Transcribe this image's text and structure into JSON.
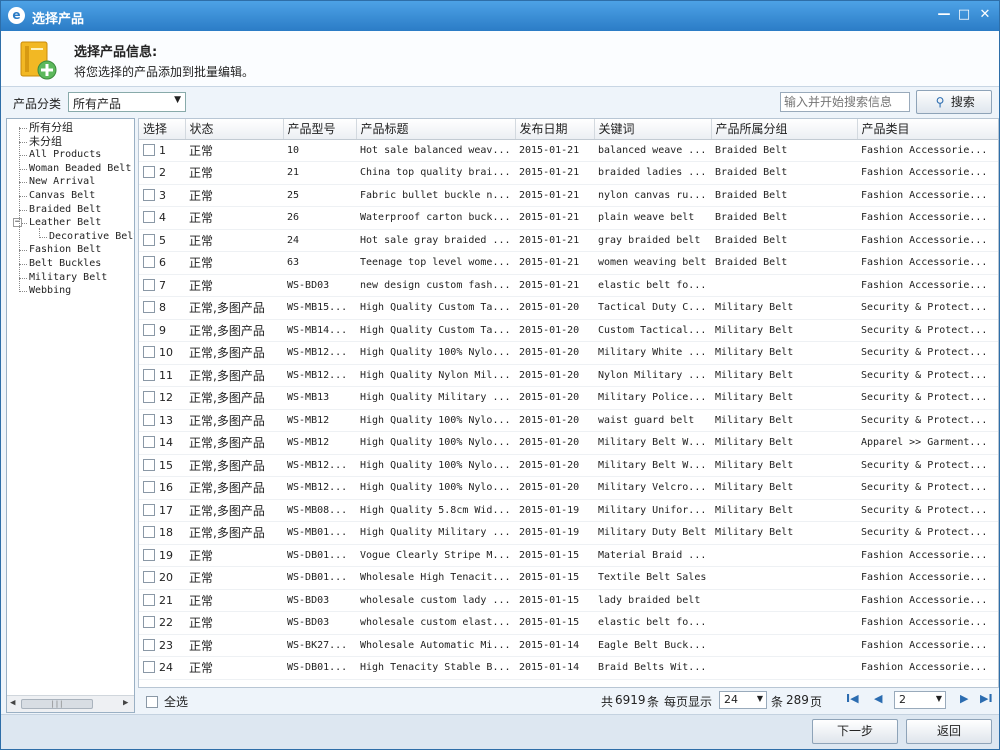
{
  "window": {
    "title": "选择产品",
    "min_glyph": "—",
    "max_glyph": "□",
    "close_glyph": "✕"
  },
  "header": {
    "title": "选择产品信息:",
    "subtitle": "将您选择的产品添加到批量编辑。"
  },
  "filter": {
    "category_label": "产品分类",
    "category_value": "所有产品",
    "search_placeholder": "输入并开始搜索信息",
    "search_button": "搜索"
  },
  "tree": {
    "items": [
      {
        "label": "所有分组",
        "level": 1
      },
      {
        "label": "未分组",
        "level": 1
      },
      {
        "label": "All Products",
        "level": 1
      },
      {
        "label": "Woman Beaded Belt",
        "level": 1
      },
      {
        "label": "New Arrival",
        "level": 1
      },
      {
        "label": "Canvas Belt",
        "level": 1
      },
      {
        "label": "Braided Belt",
        "level": 1
      },
      {
        "label": "Leather Belt",
        "level": 1,
        "expander": "−"
      },
      {
        "label": "Decorative Belt",
        "level": 2
      },
      {
        "label": "Fashion Belt",
        "level": 1
      },
      {
        "label": "Belt Buckles",
        "level": 1
      },
      {
        "label": "Military Belt",
        "level": 1
      },
      {
        "label": "Webbing",
        "level": 1
      }
    ]
  },
  "table": {
    "columns": [
      "选择",
      "状态",
      "产品型号",
      "产品标题",
      "发布日期",
      "关键词",
      "产品所属分组",
      "产品类目"
    ],
    "rows": [
      [
        "1",
        "正常",
        "10",
        "Hot sale balanced weav...",
        "2015-01-21",
        "balanced weave ...",
        "Braided Belt",
        "Fashion Accessorie..."
      ],
      [
        "2",
        "正常",
        "21",
        "China top quality brai...",
        "2015-01-21",
        "braided ladies ...",
        "Braided Belt",
        "Fashion Accessorie..."
      ],
      [
        "3",
        "正常",
        "25",
        "Fabric bullet buckle n...",
        "2015-01-21",
        "nylon canvas ru...",
        "Braided Belt",
        "Fashion Accessorie..."
      ],
      [
        "4",
        "正常",
        "26",
        "Waterproof carton buck...",
        "2015-01-21",
        "plain weave belt",
        "Braided Belt",
        "Fashion Accessorie..."
      ],
      [
        "5",
        "正常",
        "24",
        "Hot sale gray braided ...",
        "2015-01-21",
        "gray braided belt",
        "Braided Belt",
        "Fashion Accessorie..."
      ],
      [
        "6",
        "正常",
        "63",
        "Teenage top level wome...",
        "2015-01-21",
        "women weaving belt",
        "Braided Belt",
        "Fashion Accessorie..."
      ],
      [
        "7",
        "正常",
        "WS-BD03",
        "new design custom fash...",
        "2015-01-21",
        "elastic belt fo...",
        "",
        "Fashion Accessorie..."
      ],
      [
        "8",
        "正常,多图产品",
        "WS-MB15...",
        "High Quality Custom Ta...",
        "2015-01-20",
        "Tactical Duty C...",
        "Military Belt",
        "Security & Protect..."
      ],
      [
        "9",
        "正常,多图产品",
        "WS-MB14...",
        "High Quality Custom Ta...",
        "2015-01-20",
        "Custom Tactical...",
        "Military Belt",
        "Security & Protect..."
      ],
      [
        "10",
        "正常,多图产品",
        "WS-MB12...",
        "High Quality 100% Nylo...",
        "2015-01-20",
        "Military White ...",
        "Military Belt",
        "Security & Protect..."
      ],
      [
        "11",
        "正常,多图产品",
        "WS-MB12...",
        "High Quality Nylon Mil...",
        "2015-01-20",
        "Nylon Military ...",
        "Military Belt",
        "Security & Protect..."
      ],
      [
        "12",
        "正常,多图产品",
        "WS-MB13",
        "High Quality Military ...",
        "2015-01-20",
        "Military Police...",
        "Military Belt",
        "Security & Protect..."
      ],
      [
        "13",
        "正常,多图产品",
        "WS-MB12",
        "High Quality 100% Nylo...",
        "2015-01-20",
        "waist guard belt",
        "Military Belt",
        "Security & Protect..."
      ],
      [
        "14",
        "正常,多图产品",
        "WS-MB12",
        "High Quality 100% Nylo...",
        "2015-01-20",
        "Military Belt W...",
        "Military Belt",
        "Apparel >> Garment..."
      ],
      [
        "15",
        "正常,多图产品",
        "WS-MB12...",
        "High Quality 100% Nylo...",
        "2015-01-20",
        "Military Belt W...",
        "Military Belt",
        "Security & Protect..."
      ],
      [
        "16",
        "正常,多图产品",
        "WS-MB12...",
        "High Quality 100% Nylo...",
        "2015-01-20",
        "Military Velcro...",
        "Military Belt",
        "Security & Protect..."
      ],
      [
        "17",
        "正常,多图产品",
        "WS-MB08...",
        "High Quality 5.8cm Wid...",
        "2015-01-19",
        "Military Unifor...",
        "Military Belt",
        "Security & Protect..."
      ],
      [
        "18",
        "正常,多图产品",
        "WS-MB01...",
        "High Quality Military ...",
        "2015-01-19",
        "Military Duty Belt",
        "Military Belt",
        "Security & Protect..."
      ],
      [
        "19",
        "正常",
        "WS-DB01...",
        "Vogue Clearly Stripe M...",
        "2015-01-15",
        "Material Braid ...",
        "",
        "Fashion Accessorie..."
      ],
      [
        "20",
        "正常",
        "WS-DB01...",
        "Wholesale High Tenacit...",
        "2015-01-15",
        "Textile Belt Sales",
        "",
        "Fashion Accessorie..."
      ],
      [
        "21",
        "正常",
        "WS-BD03",
        "wholesale custom lady ...",
        "2015-01-15",
        "lady braided belt",
        "",
        "Fashion Accessorie..."
      ],
      [
        "22",
        "正常",
        "WS-BD03",
        "wholesale custom elast...",
        "2015-01-15",
        "elastic belt fo...",
        "",
        "Fashion Accessorie..."
      ],
      [
        "23",
        "正常",
        "WS-BK27...",
        "Wholesale Automatic Mi...",
        "2015-01-14",
        "Eagle Belt Buck...",
        "",
        "Fashion Accessorie..."
      ],
      [
        "24",
        "正常",
        "WS-DB01...",
        "High Tenacity Stable B...",
        "2015-01-14",
        "Braid Belts Wit...",
        "",
        "Fashion Accessorie..."
      ]
    ]
  },
  "footer": {
    "select_all": "全选",
    "total_prefix": "共",
    "total_count": "6919",
    "total_suffix": "条",
    "per_page_label": "每页显示",
    "per_page_value": "24",
    "pages_prefix": "条",
    "page_count": "289",
    "pages_suffix": "页",
    "current_page": "2",
    "first_glyph": "I◀",
    "prev_glyph": "◀",
    "next_glyph": "▶",
    "last_glyph": "▶I"
  },
  "buttons": {
    "next": "下一步",
    "back": "返回"
  },
  "colors": {
    "titlebar": "#2b7cc6",
    "accent": "#2b6cb0"
  }
}
